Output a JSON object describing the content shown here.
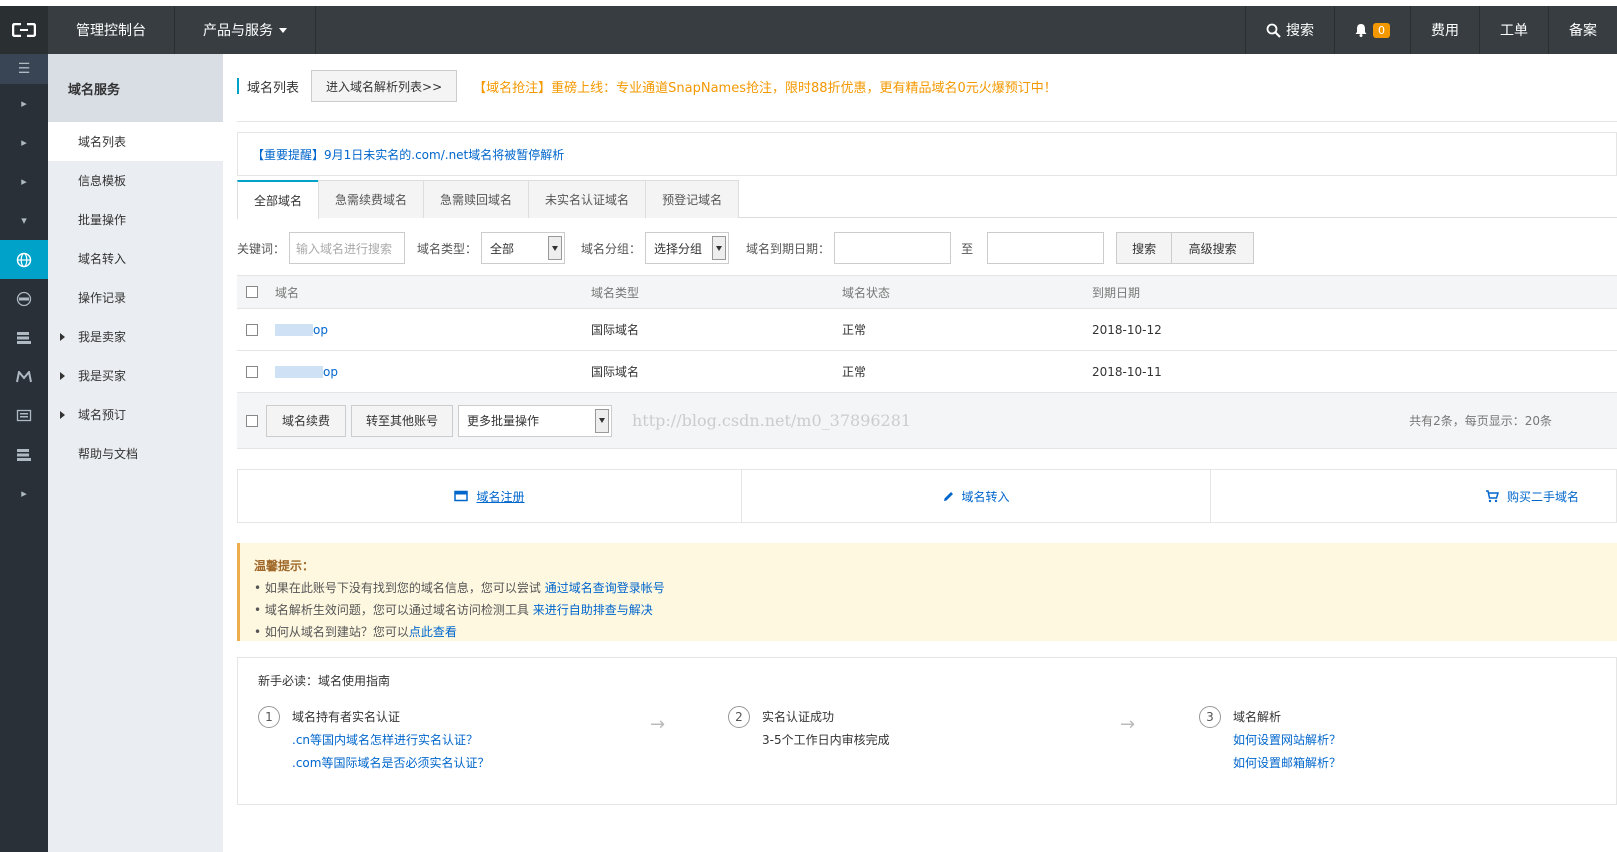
{
  "topbar": {
    "console": "管理控制台",
    "products": "产品与服务",
    "search": "搜索",
    "bell_count": "0",
    "fee": "费用",
    "ticket": "工单",
    "record": "备案"
  },
  "side": {
    "title": "域名服务",
    "items": [
      {
        "label": "域名列表"
      },
      {
        "label": "信息模板"
      },
      {
        "label": "批量操作"
      },
      {
        "label": "域名转入"
      },
      {
        "label": "操作记录"
      },
      {
        "label": "我是卖家"
      },
      {
        "label": "我是买家"
      },
      {
        "label": "域名预订"
      },
      {
        "label": "帮助与文档"
      }
    ]
  },
  "main": {
    "page_title": "域名列表",
    "dns_button": "进入域名解析列表>>",
    "promo": "【域名抢注】重磅上线：专业通道SnapNames抢注，限时88折优惠，更有精品域名0元火爆预订中！",
    "notice": "【重要提醒】9月1日未实名的.com/.net域名将被暂停解析",
    "tabs": [
      "全部域名",
      "急需续费域名",
      "急需赎回域名",
      "未实名认证域名",
      "预登记域名"
    ]
  },
  "filters": {
    "keyword_label": "关键词：",
    "keyword_placeholder": "输入域名进行搜索",
    "type_label": "域名类型：",
    "type_value": "全部",
    "group_label": "域名分组：",
    "group_value": "选择分组",
    "expire_label": "域名到期日期：",
    "to": "至",
    "search": "搜索",
    "advanced": "高级搜索"
  },
  "table": {
    "headers": [
      "域名",
      "域名类型",
      "域名状态",
      "到期日期"
    ],
    "rows": [
      {
        "name_suffix": "op",
        "type": "国际域名",
        "status": "正常",
        "date": "2018-10-12"
      },
      {
        "name_suffix": "op",
        "type": "国际域名",
        "status": "正常",
        "date": "2018-10-11"
      }
    ],
    "renew": "域名续费",
    "transfer": "转至其他账号",
    "batch": "更多批量操作",
    "watermark": "http://blog.csdn.net/m0_37896281",
    "count": "共有2条，每页显示：20条"
  },
  "quick": {
    "register": "域名注册",
    "transfer_in": "域名转入",
    "buy": "购买二手域名"
  },
  "tips": {
    "title": "温馨提示：",
    "l1": "• 如果在此账号下没有找到您的域名信息，您可以尝试 ",
    "l1_link": "通过域名查询登录帐号",
    "l2": "• 域名解析生效问题，您可以通过域名访问检测工具 ",
    "l2_link": "来进行自助排查与解决",
    "l3": "• 如何从域名到建站？您可以",
    "l3_link": "点此查看"
  },
  "guide": {
    "title": "新手必读：域名使用指南",
    "s1_num": "1",
    "s1_title": "域名持有者实名认证",
    "s1_a": ".cn等国内域名怎样进行实名认证？",
    "s1_b": ".com等国际域名是否必须实名认证？",
    "s2_num": "2",
    "s2_title": "实名认证成功",
    "s2_a": "3-5个工作日内审核完成",
    "s3_num": "3",
    "s3_title": "域名解析",
    "s3_a": "如何设置网站解析？",
    "s3_b": "如何设置邮箱解析？"
  }
}
